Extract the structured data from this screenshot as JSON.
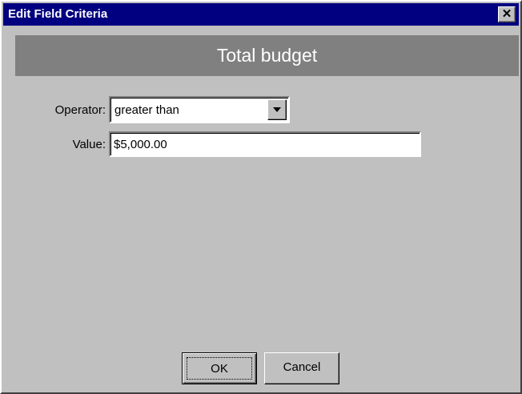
{
  "window": {
    "title": "Edit Field Criteria",
    "close_glyph": "✕",
    "close_icon": "close-icon"
  },
  "header": {
    "field_name": "Total budget"
  },
  "form": {
    "operator_label": "Operator:",
    "operator_value": "greater than",
    "dropdown_icon": "chevron-down-icon",
    "value_label": "Value:",
    "value_value": "$5,000.00"
  },
  "buttons": {
    "ok_label": "OK",
    "cancel_label": "Cancel"
  },
  "colors": {
    "title_bar": "#000080",
    "dialog_face": "#c0c0c0",
    "header_band": "#808080"
  }
}
